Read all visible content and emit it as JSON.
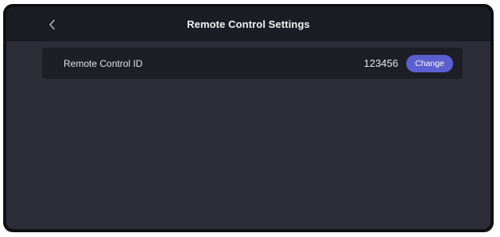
{
  "header": {
    "title": "Remote Control Settings",
    "back_icon": "chevron-left-icon"
  },
  "settings": {
    "remote_control_id": {
      "label": "Remote Control ID",
      "value": "123456",
      "button_label": "Change"
    }
  },
  "colors": {
    "accent": "#5b5fcf",
    "background": "#2d2d38",
    "header_background": "#1c1c24",
    "row_background": "#1e1e26"
  }
}
